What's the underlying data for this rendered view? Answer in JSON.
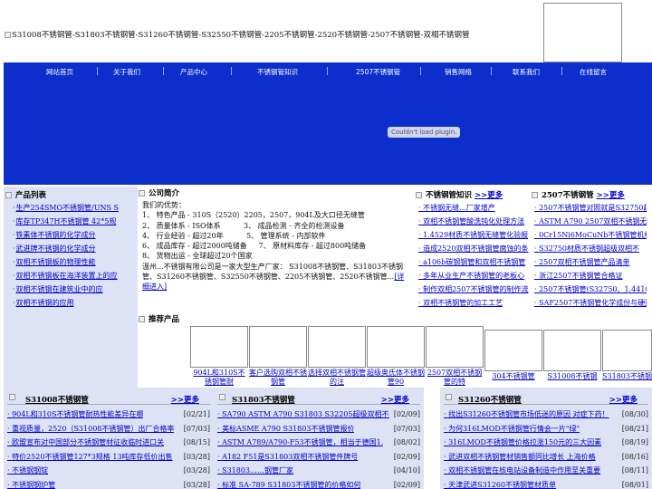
{
  "header": {
    "logo_alt": "S31008不锈钢管-S31803不锈钢管-S31260不锈钢管-S32550不锈钢管-2205不锈钢管-2520不锈钢管-2507不锈钢管-双相不锈钢管"
  },
  "nav": {
    "items": [
      "网站首页",
      "关于我们",
      "产品中心",
      "不锈钢管知识",
      "2507不锈钢管",
      "销售网络",
      "联系我们",
      "在线留言"
    ]
  },
  "banner": {
    "plugin_message": "Couldn't load plugin."
  },
  "left_panel": {
    "title": "产品列表",
    "items": [
      "生产254SMO不锈钢管/UNS S",
      "库存TP347H不锈钢管 42*5规",
      "铁素体不锈钢的化学成分",
      "武进牌不锈钢的化学成分",
      "双相不锈钢板的物理性能",
      "双相不锈钢板在海洋装置上的应",
      "双相不锈钢在建筑业中的应",
      "双相不锈钢的应用"
    ]
  },
  "intro": {
    "title": "公司简介",
    "body": "我们的优势：\n1、 特色产品 - 310S（2520）2205，2507，904L及大口径无缝管\n2、 质量体系 - ISO体系          3、 成品检测 - 齐全的检测设备\n4、 行业经验 - 超过20年          5、 管理系统 - 内部软件\n6、 成品库存 - 超过2000吨储备     7、 原材料库存 - 超过800吨储备\n8、 货物出运 - 全球超过20个国家\n溫州...不锈钢有限公司是一家大型生产厂家： S31008不锈钢管、S31803不锈钢管、S31260不锈钢管、S32550不锈钢管、2205不锈钢管、2520不锈钢管...",
    "more_link": "[详细进入]"
  },
  "news": {
    "title": "不锈钢管知识",
    "more": ">>更多",
    "items": [
      "不锈钢无缝...厂家增产",
      "双相不锈钢管酸洗钝化处理方法",
      "1.4529材质不锈钢无缝管化验报",
      "造成2520双相不锈钢管腐蚀的条",
      "a106b碳钢钢管和双相不锈钢管",
      "多年从业生产不锈钢管的老板心",
      "制作双相2507不锈钢管的制作流",
      "双相不锈钢管的加工工艺"
    ]
  },
  "proknow": {
    "title": "2507不锈钢管",
    "more": ">>更多",
    "items": [
      "2507不锈钢管对照就是S32750超",
      "ASTM A790 2507双相不锈钢无缝",
      "0Cr15Ni6MoCuNb不锈钢管机械性",
      "S32750材质不锈钢超级双相不",
      "2507双相不锈钢管产品清单",
      "浙江2507不锈钢管合格证",
      "2507不锈钢管(S32750、1.4410)",
      "SAF2507不锈钢管化学成份与硬图"
    ]
  },
  "products": {
    "title": "推荐产品",
    "items": [
      "904L和310S不锈钢管耐",
      "客户选购双相不锈钢管",
      "选择双相不锈钢管的注",
      "超级奥氏体不锈钢管90",
      "2507双相不锈钢管的特",
      "304不锈钢管",
      "S31008不锈钢",
      "S31803不锈钢"
    ]
  },
  "bottom": [
    {
      "title": "S31008不锈钢管",
      "more": ">>更多",
      "rows": [
        {
          "text": "904L和310S不锈钢管耐热性能差异在哪",
          "date": "[02/21]"
        },
        {
          "text": "重视质量，2520（S31008不锈钢管）出厂合格率",
          "date": "[07/03]"
        },
        {
          "text": "欧盟宣布对中国部分不锈钢管材征收临时进口关",
          "date": "[08/15]"
        },
        {
          "text": "特价2520不锈钢管127*3规格 13吨库存低价出售",
          "date": "[03/28]"
        },
        {
          "text": "不锈钢钢锭",
          "date": "[03/28]"
        },
        {
          "text": "不锈钢钢炉管",
          "date": "[03/28]"
        }
      ]
    },
    {
      "title": "S31803不锈钢管",
      "more": ">>更多",
      "rows": [
        {
          "text": "SA790 ASTM A790 S31803 S32205超级双相不锈钢",
          "date": "[02/09]"
        },
        {
          "text": "美标ASME A790 S31803不锈钢管报价",
          "date": "[07/03]"
        },
        {
          "text": "ASTM A789/A790-F53不锈钢管，相当于德国1.",
          "date": "[08/02]"
        },
        {
          "text": "A182 F51是S31803双相不锈钢管件牌号",
          "date": "[02/09]"
        },
        {
          "text": "S31803……钢管厂家",
          "date": "[04/10]"
        },
        {
          "text": "标准 SA-789 S31803不锈钢管的价格如何",
          "date": "[02/09]"
        }
      ]
    },
    {
      "title": "S31260不锈钢管",
      "more": ">>更多",
      "rows": [
        {
          "text": "找出S31260不锈钢管市场低迷的原因 对症下药！",
          "date": "[08/30]"
        },
        {
          "text": "为何316LMOD不锈钢管行情会一片\"绿\"",
          "date": "[08/21]"
        },
        {
          "text": "316LMOD不锈钢管价格拉涨150元的三大因素",
          "date": "[08/19]"
        },
        {
          "text": "武进双相不锈钢管材销售额同比增长 上海价格",
          "date": "[08/16]"
        },
        {
          "text": "双相不锈钢管在核电站设备制造中作用至关重要",
          "date": "[08/11]"
        },
        {
          "text": "天津武进S31260不锈钢管材质单",
          "date": "[08/01]"
        }
      ]
    }
  ]
}
